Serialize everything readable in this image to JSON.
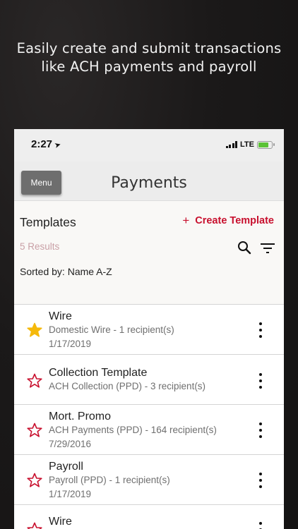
{
  "promo": {
    "line1": "Easily create and submit transactions",
    "line2": "like ACH payments and payroll"
  },
  "status_bar": {
    "time": "2:27",
    "network": "LTE",
    "location_icon": "location-arrow-icon",
    "battery_level": 0.75,
    "battery_color": "#5bc236"
  },
  "nav": {
    "menu_label": "Menu",
    "title": "Payments"
  },
  "header": {
    "section_title": "Templates",
    "create_label": "Create Template",
    "results": "5 Results",
    "sorted_by": "Sorted by: Name A-Z"
  },
  "accent_color": "#c8102e",
  "favorite_color": "#f5b90b",
  "templates": [
    {
      "name": "Wire",
      "detail": "Domestic Wire - 1 recipient(s)",
      "date": "1/17/2019",
      "favorite": true
    },
    {
      "name": "Collection Template",
      "detail": "ACH Collection (PPD) - 3 recipient(s)",
      "date": "",
      "favorite": false
    },
    {
      "name": "Mort. Promo",
      "detail": "ACH Payments (PPD) - 164 recipient(s)",
      "date": "7/29/2016",
      "favorite": false
    },
    {
      "name": "Payroll",
      "detail": "Payroll (PPD) - 1 recipient(s)",
      "date": "1/17/2019",
      "favorite": false
    },
    {
      "name": "Wire",
      "detail": "",
      "date": "",
      "favorite": false
    }
  ]
}
